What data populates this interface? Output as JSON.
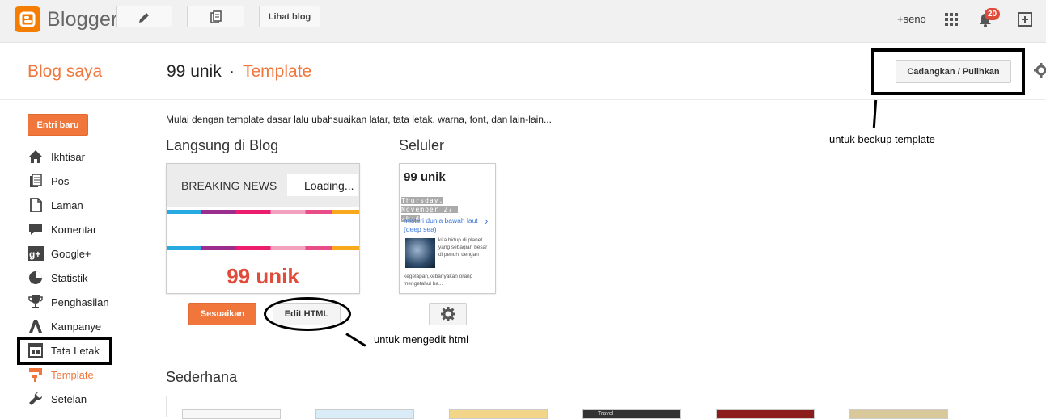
{
  "topbar": {
    "logo_text": "Blogger",
    "view_blog_label": "Lihat blog",
    "user_label": "+seno",
    "notification_count": "20"
  },
  "header": {
    "section_title": "Blog saya",
    "blog_name": "99 unik",
    "separator": "·",
    "page_title": "Template",
    "backup_button_label": "Cadangkan / Pulihkan",
    "backup_annotation": "untuk beckup template"
  },
  "sidebar": {
    "new_post_label": "Entri baru",
    "items": [
      {
        "label": "Ikhtisar",
        "icon": "home-icon"
      },
      {
        "label": "Pos",
        "icon": "posts-icon"
      },
      {
        "label": "Laman",
        "icon": "pages-icon"
      },
      {
        "label": "Komentar",
        "icon": "comment-icon"
      },
      {
        "label": "Google+",
        "icon": "google-plus-icon"
      },
      {
        "label": "Statistik",
        "icon": "stats-icon"
      },
      {
        "label": "Penghasilan",
        "icon": "trophy-icon"
      },
      {
        "label": "Kampanye",
        "icon": "adwords-icon"
      },
      {
        "label": "Tata Letak",
        "icon": "layout-icon"
      },
      {
        "label": "Template",
        "icon": "template-icon",
        "active": true
      },
      {
        "label": "Setelan",
        "icon": "wrench-icon"
      }
    ]
  },
  "main": {
    "intro_text": "Mulai dengan template dasar lalu ubahsuaikan latar, tata letak, warna, font, dan lain-lain...",
    "live_title": "Langsung di Blog",
    "mobile_title": "Seluler",
    "live_preview": {
      "ticker_label": "BREAKING NEWS",
      "ticker_status": "Loading...",
      "blog_title": "99 unik"
    },
    "mobile_preview": {
      "blog_title": "99 unik",
      "date": "Thursday, November 27, 2014",
      "post_title": "misteri dunia bawah laut (deep sea)",
      "snippet_1": "kita hidup di planet yang sebagian besar di penuhi dengan",
      "snippet_2": "kegelapan,kebanyakan orang mengetahui ba..."
    },
    "customize_label": "Sesuaikan",
    "edit_html_label": "Edit HTML",
    "edit_annotation": "untuk mengedit html",
    "simple_title": "Sederhana",
    "mini_thumbs": [
      {
        "mini_label": ""
      },
      {
        "mini_label": ""
      },
      {
        "mini_label": ""
      },
      {
        "mini_label": "Travel"
      },
      {
        "mini_label": ""
      },
      {
        "mini_label": ""
      }
    ]
  },
  "colors": {
    "accent": "#f1763b",
    "logo": "#f57d00",
    "title_red": "#e04b3a",
    "badge": "#dd4b39",
    "link_blue": "#3c78d8"
  }
}
